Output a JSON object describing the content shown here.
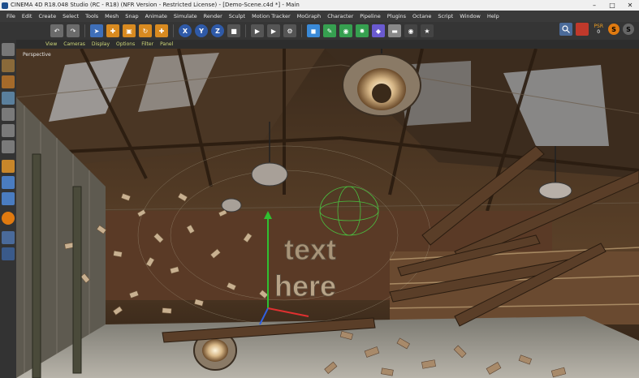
{
  "window": {
    "title": "CINEMA 4D R18.048 Studio (RC - R18) (NFR Version - Restricted License) - [Demo-Scene.c4d *] - Main"
  },
  "menu": {
    "items": [
      "File",
      "Edit",
      "Create",
      "Select",
      "Tools",
      "Mesh",
      "Snap",
      "Animate",
      "Simulate",
      "Render",
      "Sculpt",
      "Motion Tracker",
      "MoGraph",
      "Character",
      "Pipeline",
      "Plugins",
      "Octane",
      "Script",
      "Window",
      "Help"
    ]
  },
  "toolbar": {
    "axis_labels": [
      "X",
      "Y",
      "Z"
    ]
  },
  "psr": {
    "label": "PSR",
    "value": "0"
  },
  "viewport": {
    "menu": [
      "View",
      "Cameras",
      "Display",
      "Options",
      "Filter",
      "Panel"
    ],
    "label": "Perspective",
    "scene_text_1": "text",
    "scene_text_2": "here"
  },
  "colors": {
    "accent": "#f3a020",
    "axis_x": "#e03030",
    "axis_y": "#30c030",
    "axis_z": "#3060e0"
  }
}
